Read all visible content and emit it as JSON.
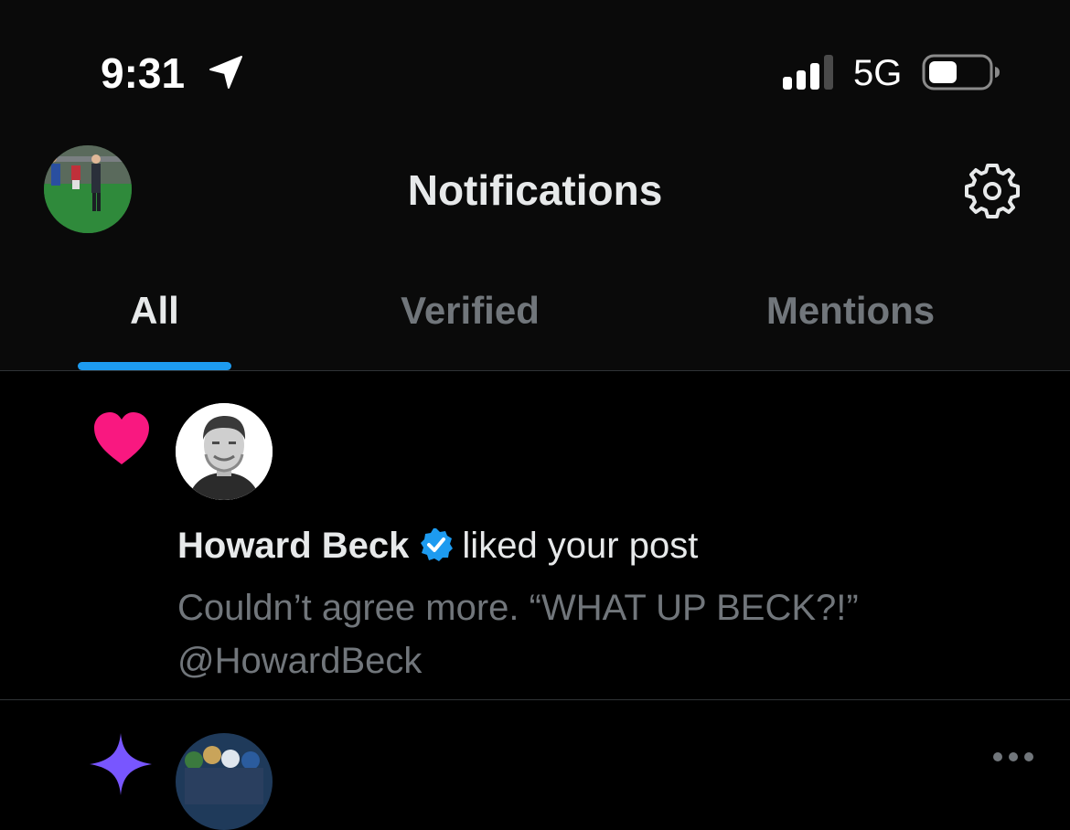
{
  "status_bar": {
    "time": "9:31",
    "network": "5G",
    "location_icon": "location-arrow-icon",
    "signal_icon": "cellular-signal-icon",
    "battery_icon": "battery-icon"
  },
  "header": {
    "title": "Notifications",
    "settings_icon": "gear-icon"
  },
  "tabs": [
    {
      "label": "All",
      "selected": true
    },
    {
      "label": "Verified",
      "selected": false
    },
    {
      "label": "Mentions",
      "selected": false
    }
  ],
  "notifications": [
    {
      "type_icon": "heart-icon",
      "actor_name": "Howard Beck",
      "verified": true,
      "action": "liked your post",
      "post_text_line1": "Couldn’t agree more. “WHAT UP BECK?!”",
      "post_text_line2": "@HowardBeck"
    },
    {
      "type_icon": "sparkle-icon",
      "more_icon": "more-icon"
    }
  ],
  "colors": {
    "background": "#000000",
    "header_background": "#0a0a0a",
    "accent": "#1d9bf0",
    "like": "#f91880",
    "sparkle": "#7856ff",
    "secondary_text": "#71767b",
    "primary_text": "#e7e9ea",
    "divider": "#2f3336"
  }
}
